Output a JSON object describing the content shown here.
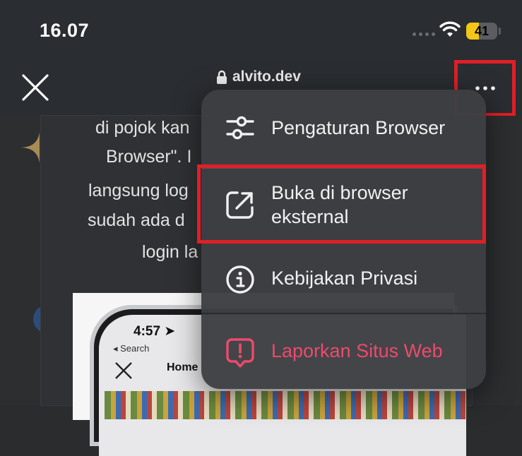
{
  "status_bar": {
    "time": "16.07",
    "battery_percent": "41",
    "battery_level": 0.41
  },
  "header": {
    "url": "alvito.dev"
  },
  "background_text": {
    "line1": "di pojok kan",
    "line2": "Browser\". I",
    "line3": "langsung log",
    "line4": "sudah ada d",
    "line5": "login la"
  },
  "phone_screenshot": {
    "time": "4:57",
    "back_label": "◂ Search",
    "title": "Home"
  },
  "menu": {
    "items": [
      {
        "label": "Pengaturan Browser",
        "icon": "sliders-icon"
      },
      {
        "label": "Buka di browser eksternal",
        "icon": "external-link-icon"
      },
      {
        "label": "Kebijakan Privasi",
        "icon": "info-icon"
      },
      {
        "label": "Laporkan Situs Web",
        "icon": "report-icon"
      }
    ]
  },
  "colors": {
    "highlight": "#e01f26",
    "report": "#ee4a6c",
    "battery": "#f5c518"
  }
}
